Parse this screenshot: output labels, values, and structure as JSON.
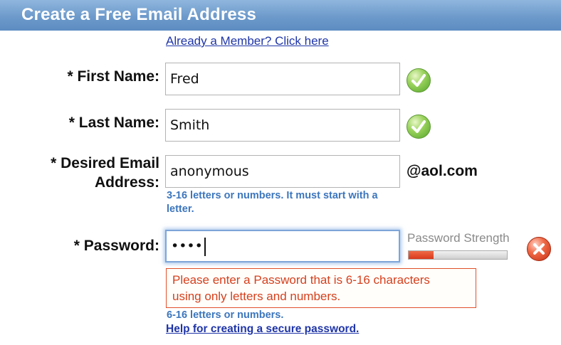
{
  "header": {
    "title": "Create a Free Email Address"
  },
  "member_link": "Already a Member? Click here",
  "first_name": {
    "label": "* First Name:",
    "value": "Fred",
    "status": "valid"
  },
  "last_name": {
    "label": "* Last Name:",
    "value": "Smith",
    "status": "valid"
  },
  "email": {
    "label_line1": "* Desired Email",
    "label_line2": "Address:",
    "value": "anonymous",
    "domain": "@aol.com",
    "hint_line1": "3-16 letters or numbers. It must start with a",
    "hint_line2": "letter."
  },
  "password": {
    "label": "* Password:",
    "masked_value": "••••",
    "status": "invalid",
    "strength_label": "Password Strength",
    "strength_fraction": 0.25,
    "error_line1": "Please enter a Password that is 6-16 characters",
    "error_line2": "using only letters and numbers.",
    "hint": "6-16 letters or numbers.",
    "help_link": "Help for creating a secure password."
  },
  "colors": {
    "header_bg": "#6d9acb",
    "link": "#1f35a8",
    "hint": "#3c76bd",
    "error": "#d6401c",
    "valid": "#55a52a",
    "invalid": "#c42e12"
  },
  "icons": {
    "valid": "check-icon",
    "invalid": "error-x-icon"
  }
}
